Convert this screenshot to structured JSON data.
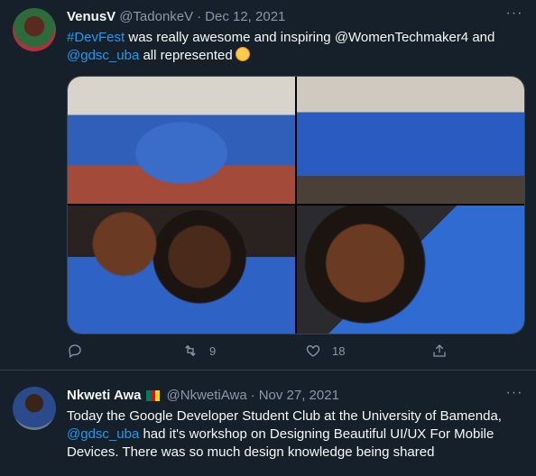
{
  "tweets": [
    {
      "name": "VenusV",
      "handle": "@TadonkeV",
      "separator": "·",
      "date": "Dec 12, 2021",
      "text_parts": [
        "#DevFest",
        " was really awesome and inspiring @WomenTechmaker4 and ",
        "@gdsc_uba",
        " all represented"
      ],
      "retweets": "9",
      "likes": "18"
    },
    {
      "name": "Nkweti Awa",
      "handle": "@NkwetiAwa",
      "separator": "·",
      "date": "Nov 27, 2021",
      "text_parts": [
        "Today the Google Developer Student Club at the University of Bamenda, ",
        "@gdsc_uba",
        " had it's workshop on Designing Beautiful UI/UX For Mobile Devices. There was so much design knowledge being shared"
      ]
    }
  ],
  "icons": {
    "more": "more-icon",
    "reply": "reply-icon",
    "retweet": "retweet-icon",
    "like": "heart-icon",
    "share": "share-icon",
    "emoji": "smiling-face-with-hearts-icon",
    "flag": "cameroon-flag-icon"
  },
  "colors": {
    "background": "#15202b",
    "link": "#1d9bf0",
    "muted": "#8b98a5",
    "divider": "#38444d"
  }
}
